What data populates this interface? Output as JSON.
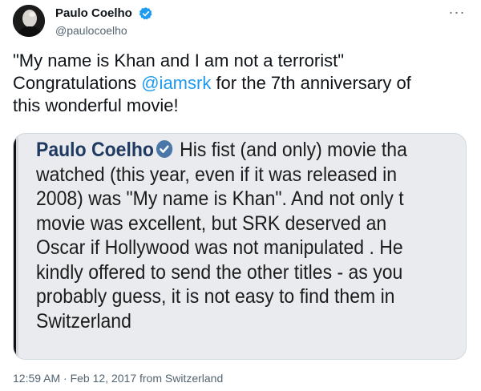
{
  "author": {
    "name": "Paulo Coelho",
    "handle": "@paulocoelho"
  },
  "tweet": {
    "text_line1": "\"My name is Khan and I am not a terrorist\"",
    "text_before_mention": "Congratulations ",
    "mention": "@iamsrk",
    "text_after_mention": " for the 7th anniversary of",
    "text_line3": "this wonderful movie!"
  },
  "quoted_image": {
    "name": "Paulo Coelho",
    "line1_rest": " His fist (and only) movie tha",
    "line2": "watched (this year, even if it was released in",
    "line3": "2008) was \"My name is Khan\". And not only t",
    "line4": "movie was excellent, but SRK deserved an",
    "line5": "Oscar if Hollywood was not manipulated . He",
    "line6": "kindly offered to send the other titles - as you",
    "line7": "probably guess, it is not easy to find them in",
    "line8": "Switzerland"
  },
  "meta": {
    "timestamp": "12:59 AM · Feb 12, 2017 from Switzerland"
  },
  "icons": {
    "verified": "verified-badge-icon",
    "more": "more-options-icon"
  },
  "colors": {
    "link": "#1d9bf0",
    "secondary_text": "#536471",
    "primary_text": "#0f1419"
  }
}
